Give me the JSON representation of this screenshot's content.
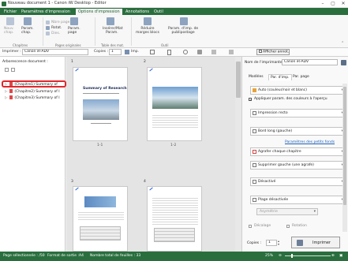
{
  "window": {
    "title": "Nouveau document 1 - Canon iW Desktop - Editor"
  },
  "ribbon_tabs": [
    "Fichier",
    "Paramètres d'impression",
    "Options d'impression",
    "Annotations",
    "Outil"
  ],
  "ribbon": {
    "nouv_chap": "Nouv.\nchap.",
    "param_chap": "Param.\nchap.",
    "chapitres": "Chapitres",
    "nbre_page": "Nbre page",
    "rotat": "Rotat.",
    "dies": "Dies.",
    "param_page": "Param.\npage",
    "pages_originales": "Pages originales",
    "inserer_mat": "Insérer/Mat",
    "param": "Param.",
    "table_des_mat": "Table des mat.",
    "reduire_marges": "Réduire\nmarges blocs",
    "param_imp": "Param. d'imp. de\npublipostage",
    "outil": "Outil"
  },
  "toolbar": {
    "imprimer_label": "Imprimer :",
    "imprimer_value": "Canon iR-ADV",
    "copies_label": "Copies :",
    "copies_value": "1",
    "imp_label": "Imp.",
    "afficher": "Afficher annot."
  },
  "left_pane": {
    "title": "Arborescence document :",
    "tree": [
      "(Chapitre1) Summary of",
      "(Chapitre2) Summary of I",
      "(Chapitre3) Summary of I"
    ]
  },
  "pages": [
    {
      "num": "1",
      "label": "1-1",
      "heading": "Summary of Research",
      "sub": "2020 report"
    },
    {
      "num": "2",
      "label": "1-2"
    },
    {
      "num": "3",
      "label": ""
    },
    {
      "num": "4",
      "label": ""
    }
  ],
  "right_pane": {
    "printer_label": "Nom de l'imprimante :",
    "printer_value": "Canon iR-ADV",
    "tabs": [
      "Modèles",
      "Par. d'imp.",
      "Par. page"
    ],
    "color_mode": "Auto (couleur/noir et blanc)",
    "apply_colors": "Appliquer param. des couleurs à l'aperçu",
    "print_mode": "Impression recto",
    "binding": "Bord long (gauche)",
    "finish_params": "Paramètres des petits fonds",
    "staple": "Agrafer chaque chapitre",
    "delete_staples": "Supprimer gauche (une agrafe)",
    "disabled": "Désactivé",
    "range_disabled": "Plage désactivée",
    "asymmetric": "Asymétrie",
    "offset": "Décalage",
    "rotation": "Rotation",
    "copies_label": "Copies :",
    "copies_value": "1",
    "print_button": "Imprimer"
  },
  "statusbar": {
    "selected_page": "Page sélectionnée : /50",
    "output_format": "Format de sortie :A4",
    "total_sheets": "Nombre total de feuilles : 33",
    "zoom": "25%"
  }
}
